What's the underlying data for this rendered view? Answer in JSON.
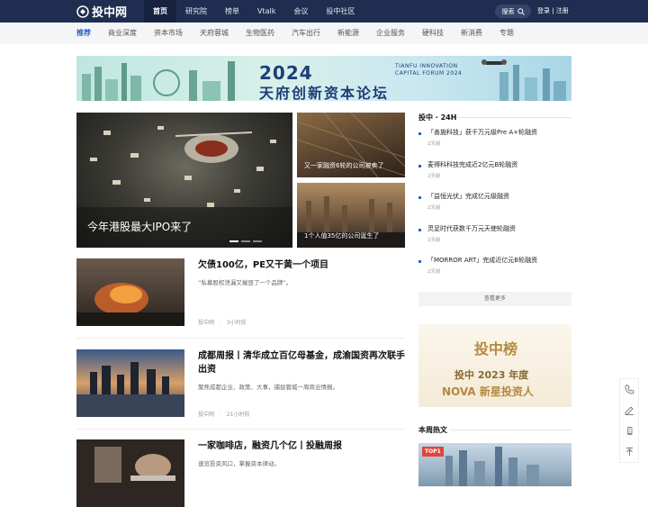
{
  "header": {
    "logo_text": "投中网",
    "nav": [
      "首页",
      "研究院",
      "榜单",
      "Vtalk",
      "会议",
      "投中社区"
    ],
    "search_label": "搜索",
    "login_label": "登录 | 注册"
  },
  "subnav": [
    "推荐",
    "商业深度",
    "资本市场",
    "天府蓉城",
    "生物医药",
    "汽车出行",
    "新能源",
    "企业服务",
    "硬科技",
    "新消费",
    "专题"
  ],
  "banner": {
    "year": "2024",
    "title": "天府创新资本论坛",
    "en_line1": "TIANFU INNOVATION",
    "en_line2": "CAPITAL FORUM 2024"
  },
  "hero": {
    "caption": "今年港股最大IPO来了"
  },
  "side_pics": [
    {
      "caption": "又一家融资6轮的公司被卖了"
    },
    {
      "caption": "1个人值35亿的公司诞生了"
    }
  ],
  "articles": [
    {
      "title": "欠债100亿，PE又干黄一个项目",
      "desc": "“私募股权泄漏又摧毁了一个品牌”。",
      "source": "投中网",
      "time": "3小时前"
    },
    {
      "title": "成都周报丨清华成立百亿母基金，成渝国资再次联手出资",
      "desc": "聚焦成都企业、政策、大事，捕捉蓉城一周商业情报。",
      "source": "投中网",
      "time": "21小时前"
    },
    {
      "title": "一家咖啡店，融资几个亿丨投融周报",
      "desc": "速览投资风口，掌握资本律动。"
    }
  ],
  "sidebar": {
    "heading": "投中 · 24H",
    "news": [
      {
        "title": "「善施科技」获千万元级Pre A+轮融资",
        "time": "2天前"
      },
      {
        "title": "麦得科科技完成近2亿元B轮融资",
        "time": "2天前"
      },
      {
        "title": "「益恒光伏」完成亿元级融资",
        "time": "2天前"
      },
      {
        "title": "灵足时代获数千万元天使轮融资",
        "time": "2天前"
      },
      {
        "title": "「MORROR ART」完成近亿元B轮融资",
        "time": "2天前"
      }
    ],
    "more_label": "查看更多",
    "ad": {
      "brand": "投中榜",
      "line1": "投中 2023 年度",
      "line2": "NOVA 新星投资人"
    },
    "hot_heading": "本周热文",
    "hot_badge": "TOP1"
  }
}
